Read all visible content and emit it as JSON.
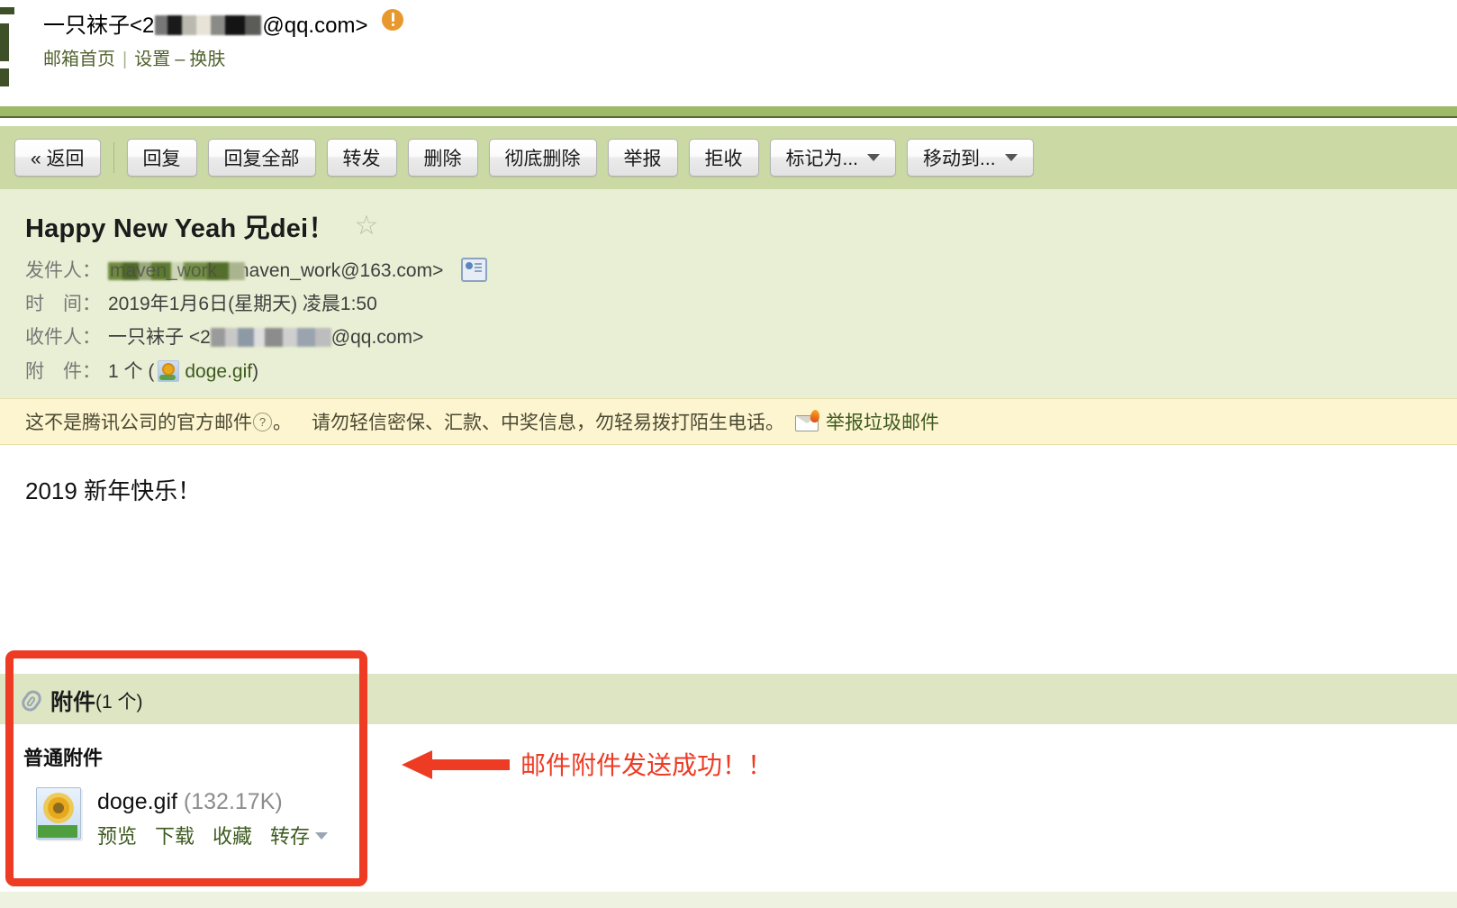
{
  "account": {
    "name": "一只袜子",
    "email_prefix": "<2",
    "email_suffix": "@qq.com>",
    "warning_icon": "exclamation-badge-icon",
    "nav": {
      "home": "邮箱首页",
      "separator": "|",
      "settings": "设置",
      "dash": "–",
      "skin": "换肤"
    }
  },
  "toolbar": {
    "buttons": [
      {
        "label": "« 返回",
        "name": "back-button",
        "dropdown": false
      },
      {
        "label": "回复",
        "name": "reply-button",
        "dropdown": false
      },
      {
        "label": "回复全部",
        "name": "reply-all-button",
        "dropdown": false
      },
      {
        "label": "转发",
        "name": "forward-button",
        "dropdown": false
      },
      {
        "label": "删除",
        "name": "delete-button",
        "dropdown": false
      },
      {
        "label": "彻底删除",
        "name": "delete-permanently-button",
        "dropdown": false
      },
      {
        "label": "举报",
        "name": "report-button",
        "dropdown": false
      },
      {
        "label": "拒收",
        "name": "reject-button",
        "dropdown": false
      },
      {
        "label": "标记为...",
        "name": "mark-as-button",
        "dropdown": true
      },
      {
        "label": "移动到...",
        "name": "move-to-button",
        "dropdown": true
      }
    ]
  },
  "mail": {
    "subject": "Happy New Yeah 兄dei！",
    "star_icon": "star-outline-icon",
    "labels": {
      "from": "发件人：",
      "date": "时　间：",
      "to": "收件人：",
      "attachment": "附　件："
    },
    "from": {
      "display_name_redacted": true,
      "address": "<maven_work@163.com>",
      "card_icon": "contact-card-icon"
    },
    "date": "2019年1月6日(星期天) 凌晨1:50",
    "to": {
      "name": "一只袜子",
      "address_prefix": "<2",
      "address_suffix": "@qq.com>"
    },
    "attachment_summary": {
      "count": "1 个",
      "open_paren": "(",
      "thumb_icon": "image-file-icon",
      "filename": "doge.gif",
      "close_paren": ")"
    },
    "body": "2019 新年快乐！"
  },
  "warning": {
    "text_before_q": "这不是腾讯公司的官方邮件",
    "question_mark": "?",
    "text_after_q": "。",
    "advice": "请勿轻信密保、汇款、中奖信息，勿轻易拨打陌生电话。",
    "spam_icon": "burning-envelope-icon",
    "spam_link": "举报垃圾邮件"
  },
  "attachments": {
    "band_title": "附件",
    "band_count": "(1 个)",
    "clip_icon": "paperclip-icon",
    "section_label": "普通附件",
    "items": [
      {
        "thumb_icon": "image-file-icon",
        "filename": "doge.gif",
        "size": "(132.17K)",
        "actions": [
          "预览",
          "下载",
          "收藏",
          "转存"
        ],
        "dropdown_icon": "chevron-down-icon"
      }
    ]
  },
  "annotation": {
    "arrow_icon": "left-arrow-icon",
    "note": "邮件附件发送成功！！",
    "color": "#ee3b24"
  }
}
